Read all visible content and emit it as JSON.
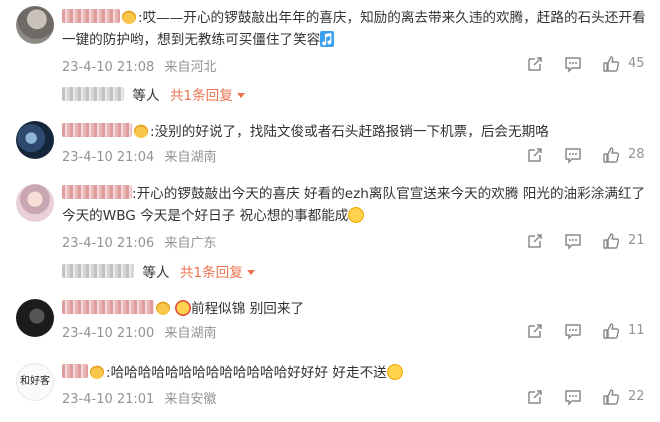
{
  "colors": {
    "link": "#eb7350",
    "meta": "#939393",
    "text": "#333333"
  },
  "comments": [
    {
      "name": "A.lu  stic e",
      "text": ":哎——开心的锣鼓敲出年年的喜庆，知励的离去带来久违的欢腾，赶路的石头还开看一键的防护哟，想到无教练可买僵住了笑容",
      "time": "23-4-10 21:08",
      "location": "来自河北",
      "likes": "45",
      "reply": {
        "who": "等人",
        "link": "共1条回复"
      }
    },
    {
      "name": " ",
      "text": ":没别的好说了，找陆文俊或者石头赶路报销一下机票，后会无期咯",
      "time": "23-4-10 21:04",
      "location": "来自湖南",
      "likes": "28"
    },
    {
      "name": "Caremen l",
      "text": ":开心的锣鼓敲出今天的喜庆 好看的ezh离队官宣送来今天的欢腾 阳光的油彩涂满红了今天的WBG 今天是个好日子 祝心想的事都能成",
      "time": "23-4-10 21:06",
      "location": "来自广东",
      "likes": "21",
      "reply": {
        "who": "等人",
        "link": "共1条回复"
      }
    },
    {
      "name": " ",
      "text": "前程似锦 别回来了",
      "time": "23-4-10 21:00",
      "location": "来自湖南",
      "likes": "11"
    },
    {
      "name": " ",
      "text": ":哈哈哈哈哈哈哈哈哈哈哈哈哈好好好 好走不送",
      "time": "23-4-10 21:01",
      "location": "来自安徽",
      "likes": "22",
      "avatar_text": "和好客"
    }
  ],
  "icons": [
    "share-icon",
    "comment-icon",
    "like-icon"
  ]
}
